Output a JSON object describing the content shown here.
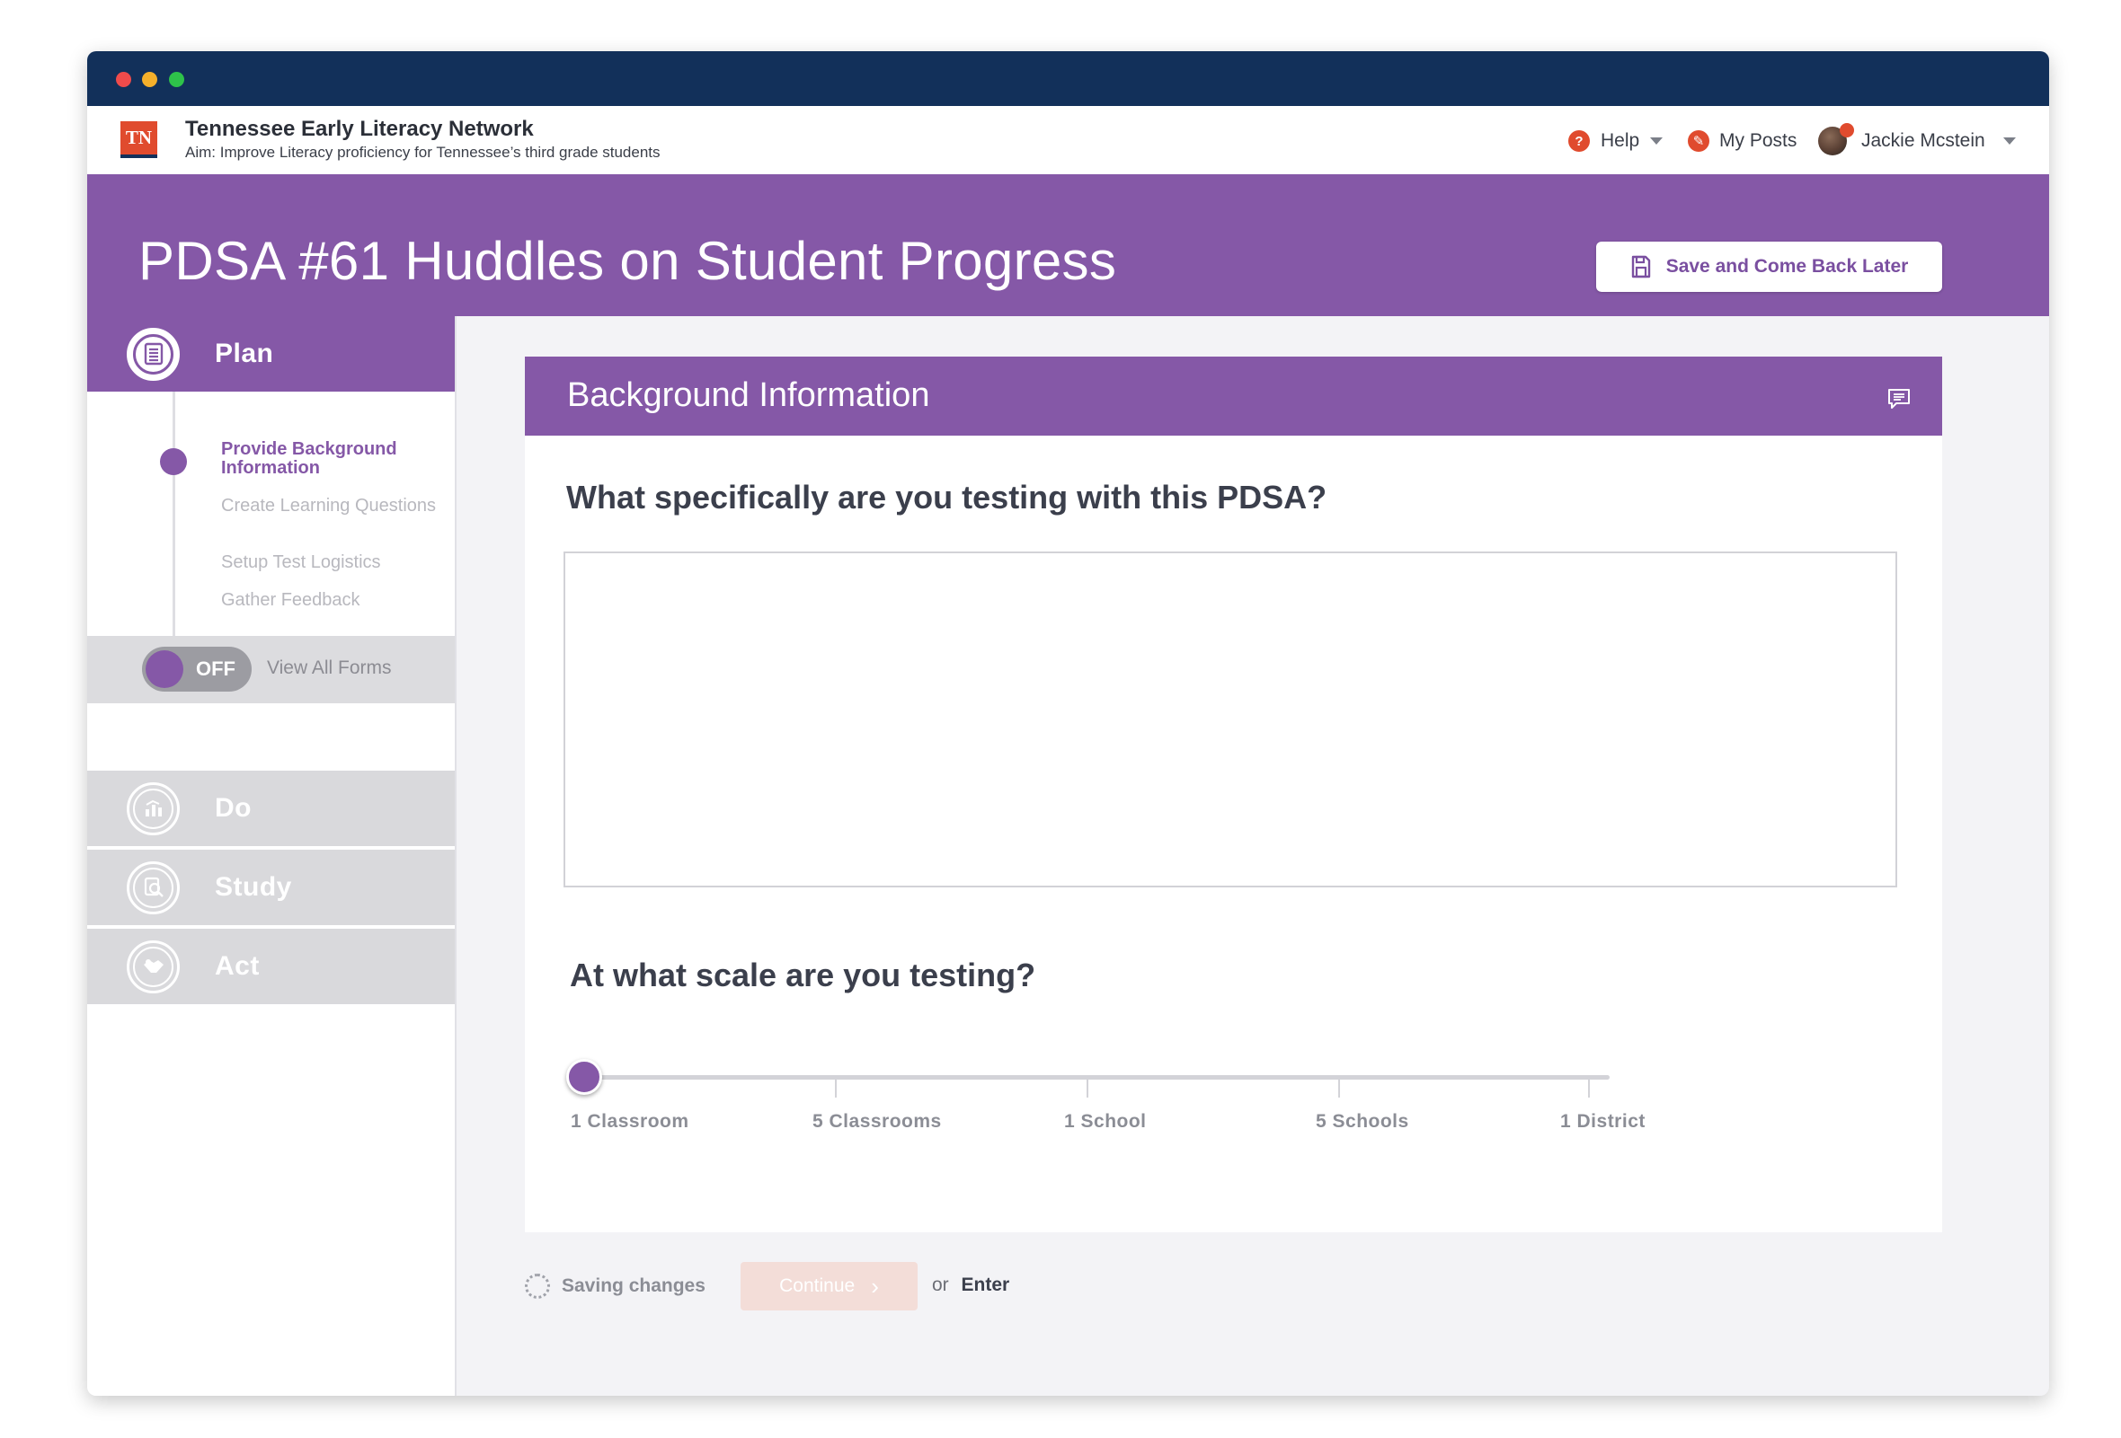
{
  "header": {
    "logo_text": "TN",
    "network_name": "Tennessee Early Literacy Network",
    "aim": "Aim: Improve Literacy proficiency for Tennessee’s third grade students",
    "help_label": "Help",
    "my_posts_label": "My Posts",
    "user_name": "Jackie Mcstein"
  },
  "banner": {
    "title": "PDSA #61 Huddles on Student Progress",
    "save_label": "Save and Come Back Later"
  },
  "sidebar": {
    "phases": [
      {
        "label": "Plan",
        "active": true
      },
      {
        "label": "Do",
        "active": false
      },
      {
        "label": "Study",
        "active": false
      },
      {
        "label": "Act",
        "active": false
      }
    ],
    "steps": [
      {
        "label": "Provide Background Information",
        "current": true
      },
      {
        "label": "Create Learning Questions",
        "current": false
      },
      {
        "label": "Setup Test Logistics",
        "current": false
      },
      {
        "label": "Gather Feedback",
        "current": false
      }
    ],
    "toggle_state": "OFF",
    "toggle_label": "View All Forms"
  },
  "form": {
    "section_title": "Background Information",
    "question_1": "What specifically are you testing with this PDSA?",
    "answer_1": "",
    "question_2": "At what scale are you testing?",
    "scale_options": [
      "1 Classroom",
      "5 Classrooms",
      "1 School",
      "5 Schools",
      "1 District"
    ],
    "scale_selected": "1 Classroom"
  },
  "footer": {
    "saving_text": "Saving changes",
    "continue_label": "Continue",
    "or_text": "or",
    "enter_text": "Enter"
  },
  "colors": {
    "brand_purple": "#8558a7",
    "title_bar": "#12305a",
    "accent_orange": "#e04b2e"
  }
}
